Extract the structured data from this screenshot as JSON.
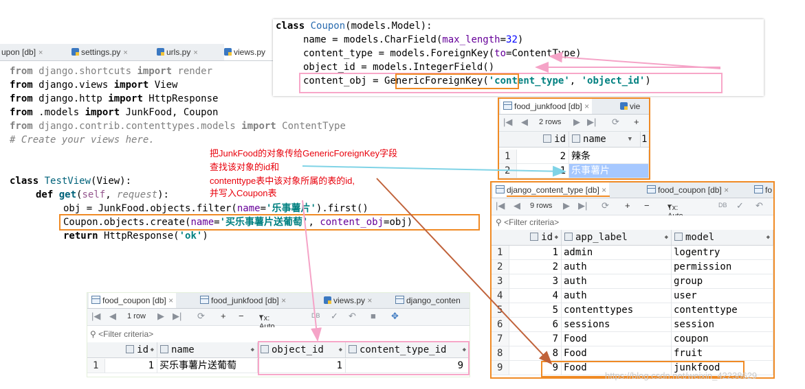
{
  "editor": {
    "tabs": [
      {
        "label": "upon [db]"
      },
      {
        "label": "settings.py"
      },
      {
        "label": "urls.py"
      },
      {
        "label": "views.py"
      }
    ],
    "code": {
      "l1": [
        "from",
        " django.shortcuts ",
        "import",
        " render"
      ],
      "l2": [
        "from",
        " django.views ",
        "import",
        " View"
      ],
      "l3": [
        "from",
        " django.http ",
        "import",
        " HttpResponse"
      ],
      "l4": [
        "from",
        " .models ",
        "import",
        " JunkFood, Coupon"
      ],
      "l5": [
        "from",
        " django.contrib.contenttypes.models ",
        "import",
        " ContentType"
      ],
      "l6": "# Create your views here.",
      "l7": [
        "class",
        " ",
        "TestView",
        "(View):"
      ],
      "l8": [
        "def",
        " ",
        "get",
        "(",
        "self",
        ", ",
        "request",
        "):"
      ],
      "l9": [
        "obj = JunkFood.objects.filter(",
        "name",
        "=",
        "'乐事薯片'",
        ").first()"
      ],
      "l10": [
        "Coupon.objects.create(",
        "name",
        "=",
        "'买乐事薯片送葡萄'",
        ", ",
        "content_obj",
        "=obj)"
      ],
      "l11": [
        "return",
        " HttpResponse(",
        "'ok'",
        ")"
      ]
    }
  },
  "model": {
    "l1": [
      "class",
      " ",
      "Coupon",
      "(models.Model):"
    ],
    "l2": [
      "name = models.CharField(",
      "max_length",
      "=",
      "32",
      ")"
    ],
    "l3": [
      "content_type = models.ForeignKey(",
      "to",
      "=ContentType)"
    ],
    "l4": "object_id = models.IntegerField()",
    "l5": [
      "content_obj = ",
      "GenericForeignKey",
      "(",
      "'content_type'",
      ", ",
      "'object_id'",
      ")"
    ]
  },
  "annotation": [
    "把JunkFood的对象传给GenericForeignKey字段",
    "查找该对象的id和",
    "contenttype表中该对象所属的表的id,",
    "并写入Coupon表"
  ],
  "junkfood_panel": {
    "tabs": [
      "food_junkfood [db]",
      "vie"
    ],
    "rows_label": "2 rows",
    "columns": [
      "id",
      "name"
    ],
    "header_extra": "1",
    "rows": [
      {
        "n": "1",
        "id": "2",
        "name": "辣条"
      },
      {
        "n": "2",
        "id": "1",
        "name": "乐事薯片"
      }
    ]
  },
  "ct_panel": {
    "tabs": [
      "django_content_type [db]",
      "food_coupon [db]",
      "fo"
    ],
    "rows_label": "9 rows",
    "tx_label": "Tx: Auto",
    "filter": "<Filter criteria>",
    "columns": [
      "id",
      "app_label",
      "model"
    ],
    "rows": [
      {
        "n": "1",
        "id": "1",
        "app_label": "admin",
        "model": "logentry"
      },
      {
        "n": "2",
        "id": "2",
        "app_label": "auth",
        "model": "permission"
      },
      {
        "n": "3",
        "id": "3",
        "app_label": "auth",
        "model": "group"
      },
      {
        "n": "4",
        "id": "4",
        "app_label": "auth",
        "model": "user"
      },
      {
        "n": "5",
        "id": "5",
        "app_label": "contenttypes",
        "model": "contenttype"
      },
      {
        "n": "6",
        "id": "6",
        "app_label": "sessions",
        "model": "session"
      },
      {
        "n": "7",
        "id": "7",
        "app_label": "Food",
        "model": "coupon"
      },
      {
        "n": "8",
        "id": "8",
        "app_label": "Food",
        "model": "fruit"
      },
      {
        "n": "9",
        "id": "9",
        "app_label": "Food",
        "model": "junkfood"
      }
    ]
  },
  "coupon_panel": {
    "tabs": [
      "food_coupon [db]",
      "food_junkfood [db]",
      "views.py",
      "django_conten"
    ],
    "rows_label": "1 row",
    "tx_label": "Tx: Auto",
    "filter": "<Filter criteria>",
    "columns": [
      "id",
      "name",
      "object_id",
      "content_type_id"
    ],
    "rows": [
      {
        "n": "1",
        "id": "1",
        "name": "买乐事薯片送葡萄",
        "object_id": "1",
        "content_type_id": "9"
      }
    ]
  },
  "watermark": "https://blog.csdn.net/weixin_42238629",
  "colors": {
    "orange": "#f08a24",
    "pink": "#f7a6c8",
    "annotation": "#e8000b",
    "selection": "#a6c8ff"
  }
}
